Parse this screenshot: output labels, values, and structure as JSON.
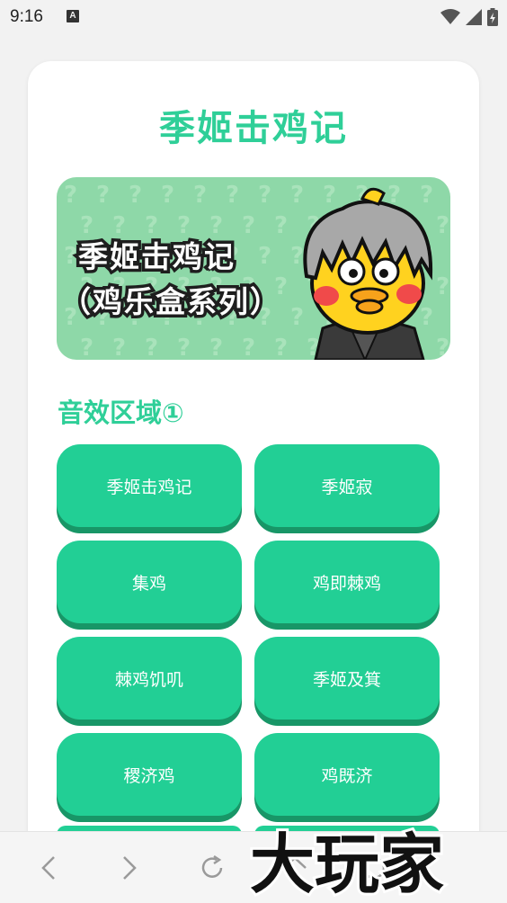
{
  "status_bar": {
    "time": "9:16",
    "notification_icon": "A"
  },
  "app": {
    "title": "季姬击鸡记"
  },
  "banner": {
    "line1": "季姬击鸡记",
    "line2": "（鸡乐盒系列）"
  },
  "section": {
    "title": "音效区域①"
  },
  "sound_buttons": [
    {
      "label": "季姬击鸡记"
    },
    {
      "label": "季姬寂"
    },
    {
      "label": "集鸡"
    },
    {
      "label": "鸡即棘鸡"
    },
    {
      "label": "棘鸡饥叽"
    },
    {
      "label": "季姬及箕"
    },
    {
      "label": "稷济鸡"
    },
    {
      "label": "鸡既济"
    }
  ],
  "watermark": {
    "text": "大玩家"
  },
  "colors": {
    "accent": "#2fcf98",
    "button": "#22cf95",
    "button_shadow": "#189667",
    "banner_bg": "#8ed8a8"
  }
}
